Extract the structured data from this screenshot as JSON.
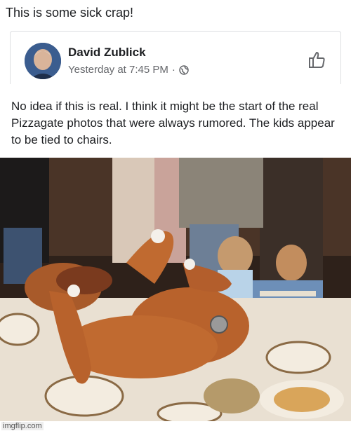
{
  "caption": "This is some sick crap!",
  "post": {
    "author": "David Zublick",
    "timestamp": "Yesterday at 7:45 PM",
    "separator": "·",
    "privacy_icon": "globe-icon",
    "action_icon": "thumbs-up-icon",
    "text": "No idea if this is real.  I think it might be the start of the real Pizzagate photos that were always rumored. The kids appear to be tied to chairs."
  },
  "watermark": "imgflip.com",
  "colors": {
    "secondary_text": "#65676b",
    "card_border": "#dddfe2"
  }
}
